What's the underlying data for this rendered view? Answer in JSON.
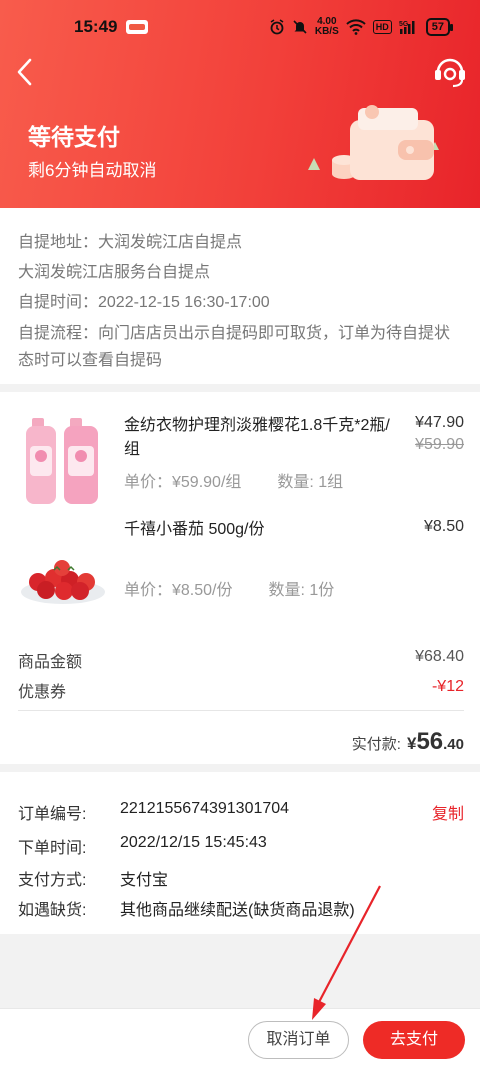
{
  "status_bar": {
    "time": "15:49",
    "speed_value": "4.00",
    "speed_unit": "KB/S",
    "network": "5G",
    "battery": "57"
  },
  "header": {
    "title": "等待支付",
    "subtitle": "剩6分钟自动取消"
  },
  "pickup": {
    "address": "自提地址：大润发皖江店自提点",
    "address_detail": "大润发皖江店服务台自提点",
    "time": "自提时间：2022-12-15 16:30-17:00",
    "flow": "自提流程：向门店店员出示自提码即可取货，订单为待自提状态时可以查看自提码"
  },
  "items": [
    {
      "name": "金纺衣物护理剂淡雅樱花1.8千克*2瓶/组",
      "price": "¥47.90",
      "original_price": "¥59.90",
      "unit_price": "单价：¥59.90/组",
      "quantity": "数量: 1组"
    },
    {
      "name": "千禧小番茄 500g/份",
      "price": "¥8.50",
      "unit_price": "单价：¥8.50/份",
      "quantity": "数量: 1份"
    }
  ],
  "summary": {
    "goods_amount_label": "商品金额",
    "goods_amount": "¥68.40",
    "coupon_label": "优惠券",
    "coupon": "-¥12",
    "paid_label": "实付款:",
    "paid_symbol": "¥",
    "paid_int": "56",
    "paid_dec": ".40"
  },
  "order": {
    "number_label": "订单编号:",
    "number": "2212155674391301704",
    "copy": "复制",
    "time_label": "下单时间:",
    "time": "2022/12/15 15:45:43",
    "pay_label": "支付方式:",
    "pay": "支付宝",
    "shortage_label": "如遇缺货:",
    "shortage": "其他商品继续配送(缺货商品退款)"
  },
  "actions": {
    "cancel": "取消订单",
    "pay": "去支付"
  },
  "colors": {
    "accent": "#e8242a",
    "header_start": "#f85c4c",
    "header_end": "#e8242a"
  }
}
